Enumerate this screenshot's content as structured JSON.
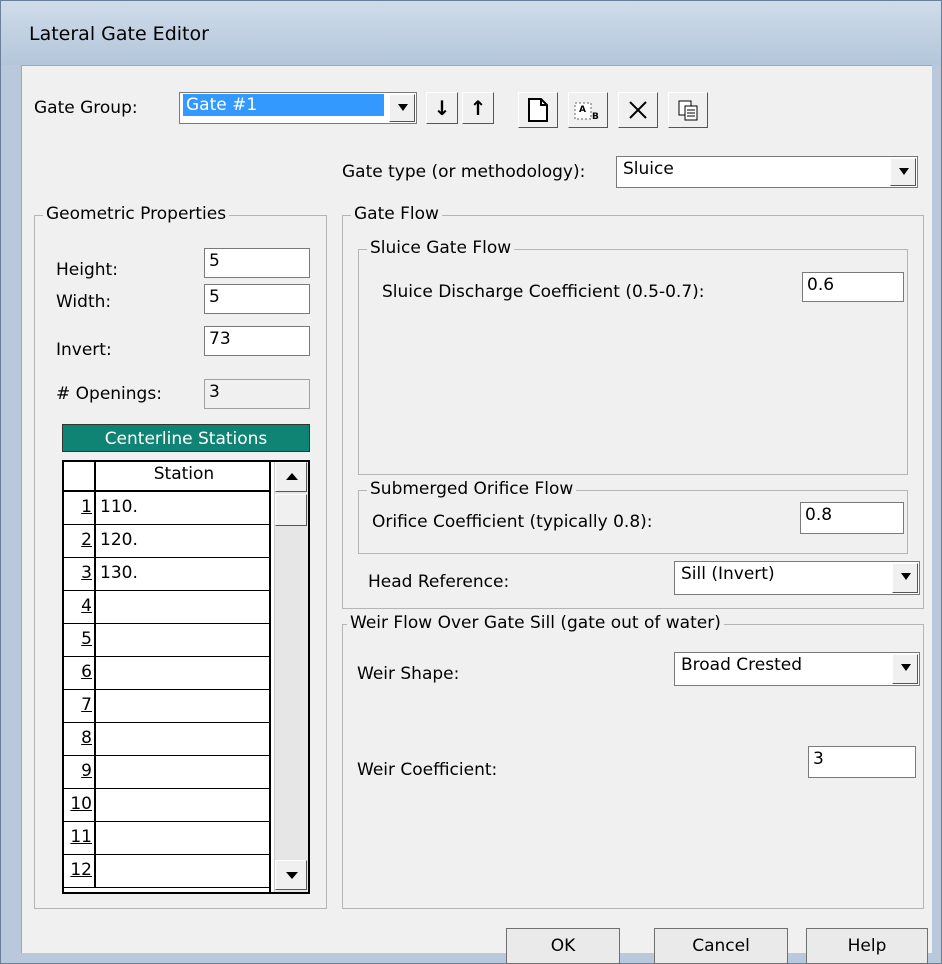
{
  "window": {
    "title": "Lateral Gate Editor"
  },
  "gate_group": {
    "label": "Gate Group:",
    "value": "Gate #1",
    "toolbar_icons": [
      "arrow-down-icon",
      "arrow-up-icon",
      "new-document-icon",
      "rename-icon",
      "delete-icon",
      "copy-icon"
    ]
  },
  "gate_type": {
    "label": "Gate type (or methodology):",
    "value": "Sluice"
  },
  "geometric": {
    "title": "Geometric Properties",
    "height_label": "Height:",
    "height": "5",
    "width_label": "Width:",
    "width": "5",
    "invert_label": "Invert:",
    "invert": "73",
    "openings_label": "# Openings:",
    "openings": "3",
    "stations_header": "Centerline Stations",
    "station_col": "Station",
    "rows": [
      "1",
      "2",
      "3",
      "4",
      "5",
      "6",
      "7",
      "8",
      "9",
      "10",
      "11",
      "12"
    ],
    "values": [
      "110.",
      "120.",
      "130.",
      "",
      "",
      "",
      "",
      "",
      "",
      "",
      "",
      ""
    ]
  },
  "gate_flow": {
    "title": "Gate Flow",
    "sluice": {
      "title": "Sluice Gate Flow",
      "label": "Sluice Discharge Coefficient (0.5-0.7):",
      "value": "0.6"
    },
    "orifice": {
      "title": "Submerged Orifice Flow",
      "label": "Orifice Coefficient (typically 0.8):",
      "value": "0.8"
    },
    "head_ref_label": "Head Reference:",
    "head_ref_value": "Sill (Invert)"
  },
  "weir": {
    "title": "Weir Flow Over Gate Sill (gate out of water)",
    "shape_label": "Weir Shape:",
    "shape_value": "Broad Crested",
    "coef_label": "Weir Coefficient:",
    "coef_value": "3"
  },
  "buttons": {
    "ok": "OK",
    "cancel": "Cancel",
    "help": "Help"
  },
  "colors": {
    "stations_header_bg": "#108474",
    "selection": "#3399ff"
  }
}
